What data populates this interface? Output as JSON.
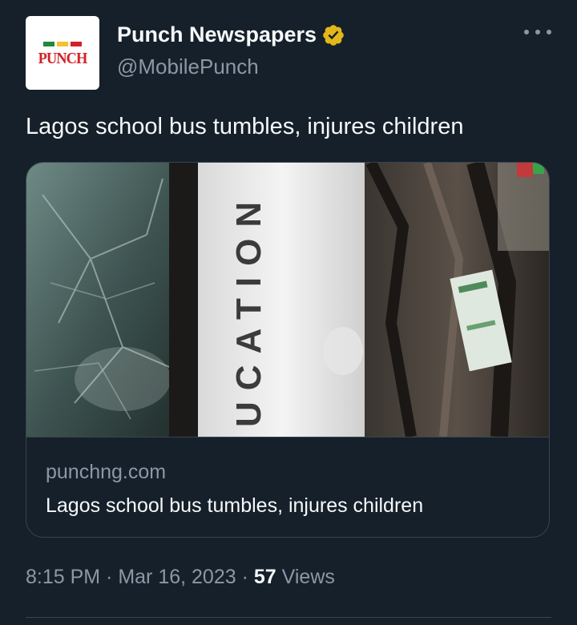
{
  "colors": {
    "background": "#15202b",
    "text_primary": "#f7f9f9",
    "text_secondary": "#8b98a5",
    "border": "#38444d",
    "verified_badge": "#e2b719",
    "punch_red": "#d42027",
    "punch_green": "#1f8a3b",
    "punch_yellow": "#f2c230"
  },
  "account": {
    "avatar_icon": "punch-logo-icon",
    "logo_text": "PUNCH",
    "display_name": "Punch Newspapers",
    "verified_icon": "verified-badge-icon",
    "handle": "@MobilePunch"
  },
  "menu": {
    "icon": "more-options-icon"
  },
  "tweet": {
    "text": "Lagos school bus tumbles, injures children"
  },
  "card": {
    "image_icon": "bus-accident-photo",
    "image_text": "UCATION",
    "domain": "punchng.com",
    "title": "Lagos school bus tumbles, injures children"
  },
  "meta": {
    "time": "8:15 PM",
    "separator": " · ",
    "date": "Mar 16, 2023",
    "views_count": "57",
    "views_label": " Views"
  }
}
